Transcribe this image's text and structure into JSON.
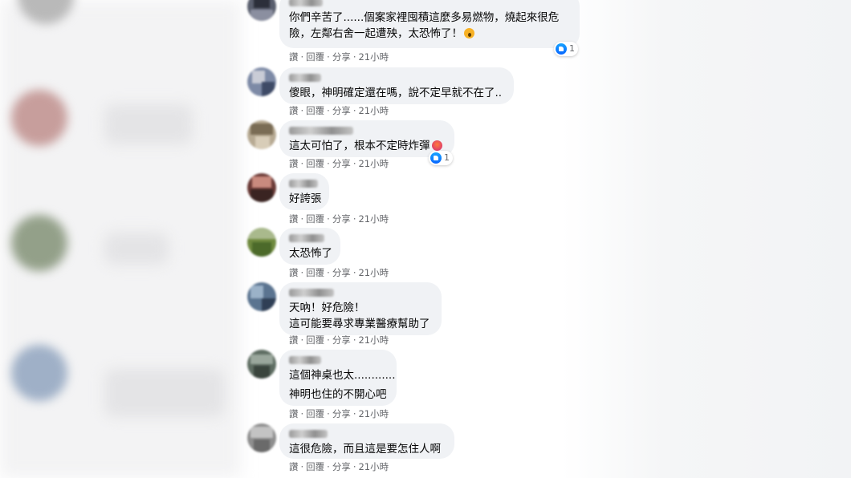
{
  "actions": {
    "like": "讚",
    "reply": "回覆",
    "share": "分享",
    "separator": "·"
  },
  "comments": [
    {
      "lines": [
        "你們辛苦了......個案家裡囤積這麼多易燃物，燒起來很危",
        "險，左鄰右舍一起遭殃，太恐怖了！"
      ],
      "emoji": "wow",
      "time": "21小時",
      "reactions": "1"
    },
    {
      "lines": [
        "傻眼，神明確定還在嗎，說不定早就不在了.."
      ],
      "time": "21小時"
    },
    {
      "lines": [
        "這太可怕了，根本不定時炸彈"
      ],
      "emoji": "angry",
      "time": "21小時",
      "reactions": "1"
    },
    {
      "lines": [
        "好誇張"
      ],
      "time": "21小時"
    },
    {
      "lines": [
        "太恐怖了"
      ],
      "time": "21小時"
    },
    {
      "lines": [
        "天吶！好危險！",
        "這可能要尋求專業醫療幫助了"
      ],
      "time": "21小時"
    },
    {
      "lines": [
        "這個神桌也太............",
        "",
        "神明也住的不開心吧"
      ],
      "time": "21小時"
    },
    {
      "lines": [
        "這很危險，而且這是要怎住人啊"
      ],
      "time": "21小時"
    }
  ]
}
